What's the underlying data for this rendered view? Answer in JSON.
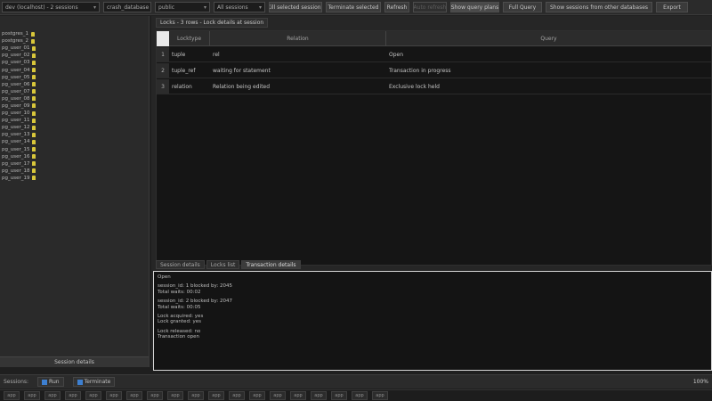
{
  "toolbar": {
    "connection_combo": "dev (localhost) - 2 sessions",
    "schema_combo": "crash_database",
    "database_combo": "public",
    "mode_combo": "All sessions",
    "buttons": [
      {
        "label": "Kill selected sessions",
        "state": "normal"
      },
      {
        "label": "Terminate selected",
        "state": "normal"
      },
      {
        "label": "Refresh",
        "state": "normal"
      },
      {
        "label": "Auto refresh",
        "state": "disabled"
      },
      {
        "label": "Show query plans",
        "state": "active"
      },
      {
        "label": "Full Query",
        "state": "normal"
      },
      {
        "label": "Show sessions from other databases",
        "state": "normal"
      },
      {
        "label": "Export",
        "state": "normal"
      }
    ]
  },
  "sidebar": {
    "sessions": [
      "postgres_1",
      "postgres_2",
      "pg_user_01",
      "pg_user_02",
      "pg_user_03",
      "pg_user_04",
      "pg_user_05",
      "pg_user_06",
      "pg_user_07",
      "pg_user_08",
      "pg_user_09",
      "pg_user_10",
      "pg_user_11",
      "pg_user_12",
      "pg_user_13",
      "pg_user_14",
      "pg_user_15",
      "pg_user_16",
      "pg_user_17",
      "pg_user_18",
      "pg_user_19"
    ],
    "footer_label": "Session details"
  },
  "results_tab": "Locks - 3 rows - Lock details at session",
  "grid": {
    "columns": [
      "Locktype",
      "Relation",
      "Query"
    ],
    "rows": [
      [
        "tuple",
        "rel",
        "Open"
      ],
      [
        "tuple_ref",
        "waiting for statement",
        "Transaction in progress"
      ],
      [
        "relation",
        "Relation being edited",
        "Exclusive lock held"
      ]
    ]
  },
  "bottom_tabs": [
    {
      "label": "Session details",
      "active": false
    },
    {
      "label": "Locks list",
      "active": false
    },
    {
      "label": "Transaction details",
      "active": true
    }
  ],
  "messages": [
    "Open",
    "",
    "session_id: 1 blocked by: 2045",
    "Total waits: 00:02",
    "",
    "session_id: 2 blocked by: 2047",
    "Total waits: 00:05",
    "",
    "Lock acquired: yes",
    "Lock granted: yes",
    "",
    "Lock released: no",
    "Transaction open"
  ],
  "statusbar": {
    "left_text": "Sessions:",
    "btn_run": "Run",
    "btn_stop": "Terminate",
    "zoom": "100%"
  },
  "taskbar": {
    "items": [
      "app",
      "app",
      "app",
      "app",
      "app",
      "app",
      "app",
      "app",
      "app",
      "app",
      "app",
      "app",
      "app",
      "app",
      "app",
      "app",
      "app",
      "app",
      "app"
    ]
  }
}
